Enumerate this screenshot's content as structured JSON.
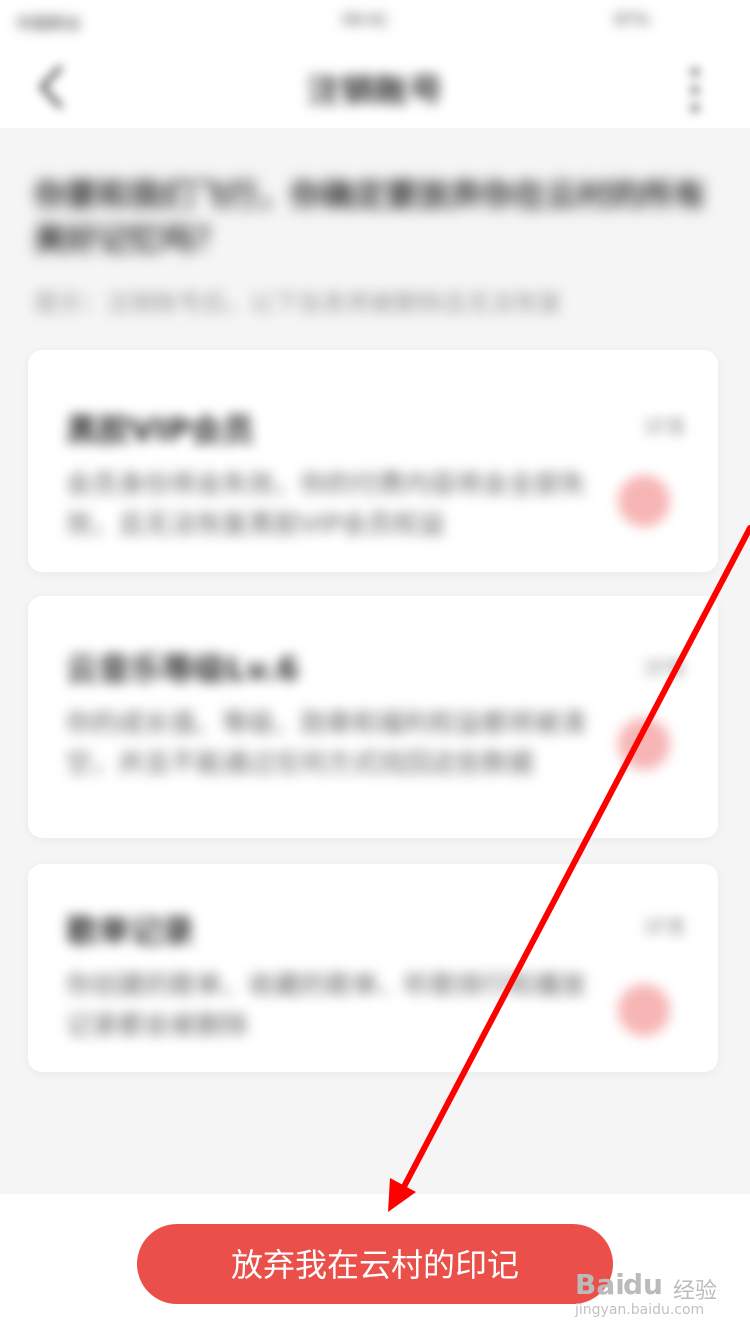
{
  "status_bar": {
    "carrier": "中国移动",
    "time": "09:41",
    "battery": "97%"
  },
  "nav": {
    "title": "注销账号"
  },
  "intro": {
    "heading": "你要和我们飞行，你确定要放弃你在云村的所有美好记忆吗？",
    "subheading": "提示：注销账号后，以下信息将被删除且无法恢复"
  },
  "cards": [
    {
      "title": "黑胶VIP会员",
      "status": "详情",
      "description": "会员身份将会失效，你的付费内容将会全部失效，且无法恢复黑胶VIP会员权益",
      "icon": "vip-icon"
    },
    {
      "title": "云音乐等级Lv.6",
      "status": "详情",
      "description": "你的成长值、等级、勋章和福利权益都将被清空，并且不能通过任何方式找回这些数据",
      "icon": "level-icon"
    },
    {
      "title": "歌单记录",
      "status": "详情",
      "description": "你创建的歌单、收藏的歌单、听歌排行和播放记录都会被删除",
      "icon": "heart-icon"
    }
  ],
  "bottom": {
    "abandon_label": "放弃我在云村的印记"
  },
  "watermark": {
    "text": "Bai",
    "du": "du",
    "cn": "经验",
    "url": "jingyan.baidu.com"
  },
  "colors": {
    "primary": "#ea4f4a",
    "arrow": "#ff0000"
  }
}
